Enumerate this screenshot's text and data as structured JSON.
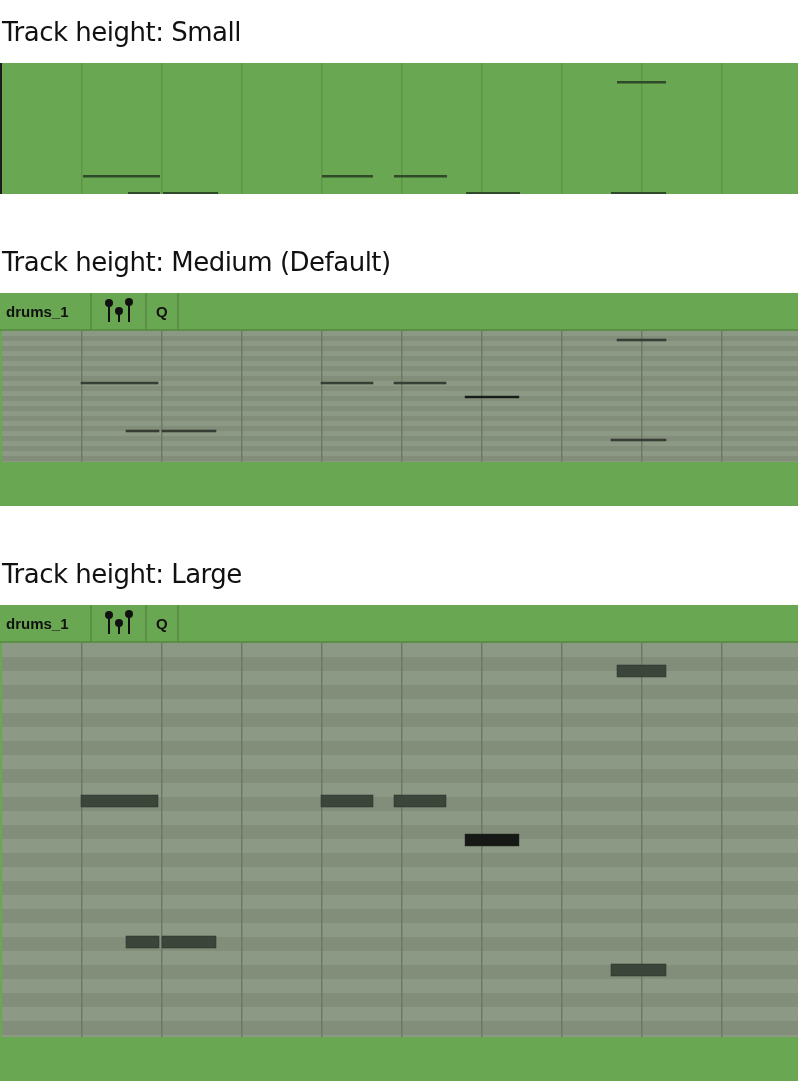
{
  "sections": [
    {
      "heading": "Track height: Small",
      "kind": "small"
    },
    {
      "heading": "Track height: Medium (Default)",
      "kind": "medium",
      "track_name": "drums_1",
      "quantize_label": "Q"
    },
    {
      "heading": "Track height: Large",
      "kind": "large",
      "track_name": "drums_1",
      "quantize_label": "Q"
    }
  ]
}
